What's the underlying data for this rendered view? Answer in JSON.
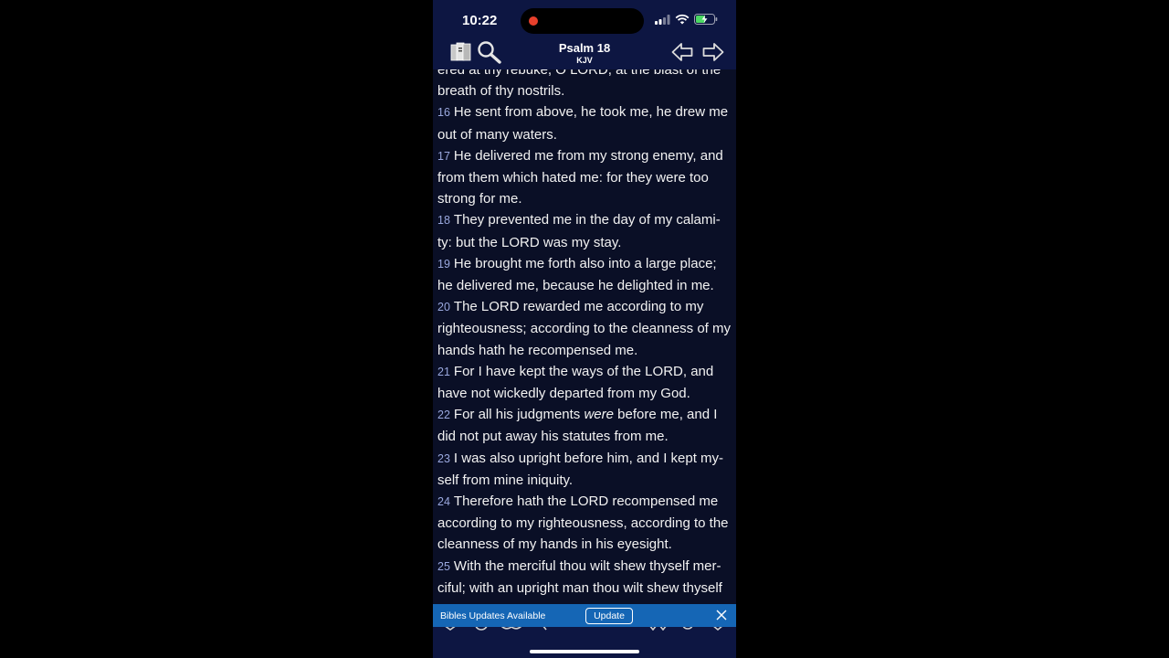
{
  "status_bar": {
    "time": "10:22"
  },
  "nav": {
    "title": "Psalm 18",
    "version": "KJV"
  },
  "icons": {
    "bible_library": "bible-books-icon",
    "search": "search-icon",
    "back": "arrow-left-icon",
    "forward": "arrow-right-icon",
    "close": "close-icon"
  },
  "verses": [
    {
      "num": "",
      "parts": [
        {
          "text": "ered at thy rebuke, O LORD, at the blast of the breath of thy nostrils."
        }
      ]
    },
    {
      "num": "16",
      "parts": [
        {
          "text": "He sent from above, he took me, he drew me out of many waters."
        }
      ]
    },
    {
      "num": "17",
      "parts": [
        {
          "text": "He delivered me from my strong enemy, and from them which hated me: for they were too strong for me."
        }
      ]
    },
    {
      "num": "18",
      "parts": [
        {
          "text": "They prevented me in the day of my calami-ty: but the LORD was my stay."
        }
      ]
    },
    {
      "num": "19",
      "parts": [
        {
          "text": "He brought me forth also into a large place; he delivered me, because he delighted in me."
        }
      ]
    },
    {
      "num": "20",
      "parts": [
        {
          "text": "The LORD rewarded me according to my righteousness; according to the cleanness of my hands hath he recompensed me."
        }
      ]
    },
    {
      "num": "21",
      "parts": [
        {
          "text": "For I have kept the ways of the LORD, and have not wickedly departed from my God."
        }
      ]
    },
    {
      "num": "22",
      "parts": [
        {
          "text": "For all his judgments "
        },
        {
          "text": "were",
          "italic": true
        },
        {
          "text": " before me, and I did not put away his statutes from me."
        }
      ]
    },
    {
      "num": "23",
      "parts": [
        {
          "text": "I was also upright before him, and I kept my-self from mine iniquity."
        }
      ]
    },
    {
      "num": "24",
      "parts": [
        {
          "text": "Therefore hath the LORD recompensed me according to my righteousness, according to the cleanness of my hands in his eyesight."
        }
      ]
    },
    {
      "num": "25",
      "parts": [
        {
          "text": "With the merciful thou wilt shew thyself mer-ciful; with an upright man thou wilt shew thyself upright;"
        }
      ]
    }
  ],
  "banner": {
    "text": "Bibles Updates Available",
    "button_label": "Update"
  },
  "colors": {
    "header_bg": "#0d1642",
    "content_bg": "#0a0f26",
    "banner_bg": "#1566b5",
    "verse_number": "#9aa8de"
  }
}
